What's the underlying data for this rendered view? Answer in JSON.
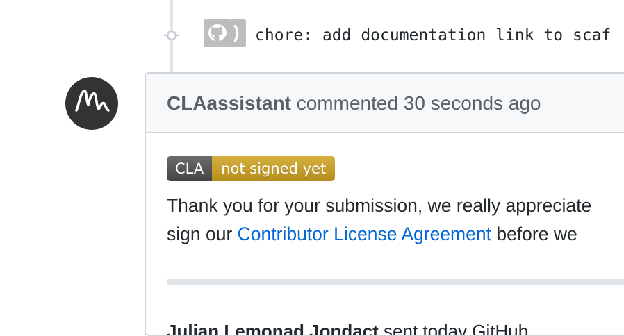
{
  "timeline": {
    "commit": {
      "message": "chore: add documentation link to scaf",
      "avatar_icon": "github-icon",
      "node_icon": "commit-node-icon"
    }
  },
  "comment": {
    "author": "CLAassistant",
    "action": "commented",
    "time": "30 seconds ago",
    "avatar_icon": "cla-assistant-logo",
    "badge": {
      "left": "CLA",
      "right": "not signed yet",
      "left_color": "#555555",
      "right_color": "#c9a12f"
    },
    "body": {
      "line1": "Thank you for your submission, we really appreciate",
      "line2_prefix": "sign our ",
      "link_text": "Contributor License Agreement",
      "line2_suffix": " before we",
      "cutoff_bold": "Julian Lemonad  Jondact",
      "cutoff_rest": "  sent today  GitHub"
    }
  },
  "colors": {
    "link": "#0366d6",
    "border": "#d1d5da",
    "header_bg": "#f6f8fa",
    "text": "#24292e",
    "muted": "#586069"
  }
}
